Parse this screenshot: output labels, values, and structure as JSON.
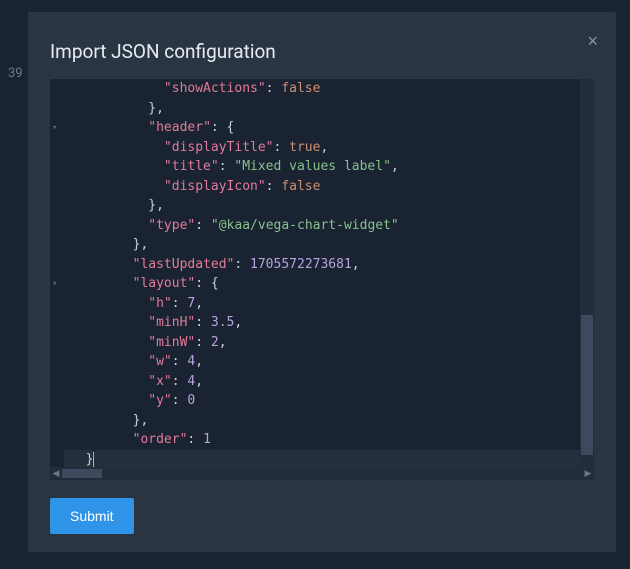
{
  "backdrop": {
    "text": "39"
  },
  "modal": {
    "title": "Import JSON configuration",
    "close_label": "×",
    "submit_label": "Submit"
  },
  "editor": {
    "fold_glyph": "▾",
    "hscroll": {
      "left_arrow": "◀",
      "right_arrow": "▶"
    },
    "lines": [
      {
        "indent": 6,
        "tokens": [
          {
            "t": "k",
            "v": "\"showActions\""
          },
          {
            "t": "p",
            "v": ": "
          },
          {
            "t": "b",
            "v": "false"
          }
        ]
      },
      {
        "indent": 5,
        "tokens": [
          {
            "t": "p",
            "v": "},"
          }
        ]
      },
      {
        "indent": 5,
        "tokens": [
          {
            "t": "k",
            "v": "\"header\""
          },
          {
            "t": "p",
            "v": ": {"
          }
        ]
      },
      {
        "indent": 6,
        "tokens": [
          {
            "t": "k",
            "v": "\"displayTitle\""
          },
          {
            "t": "p",
            "v": ": "
          },
          {
            "t": "b",
            "v": "true"
          },
          {
            "t": "p",
            "v": ","
          }
        ]
      },
      {
        "indent": 6,
        "tokens": [
          {
            "t": "k",
            "v": "\"title\""
          },
          {
            "t": "p",
            "v": ": "
          },
          {
            "t": "s",
            "v": "\"Mixed values label\""
          },
          {
            "t": "p",
            "v": ","
          }
        ]
      },
      {
        "indent": 6,
        "tokens": [
          {
            "t": "k",
            "v": "\"displayIcon\""
          },
          {
            "t": "p",
            "v": ": "
          },
          {
            "t": "b",
            "v": "false"
          }
        ]
      },
      {
        "indent": 5,
        "tokens": [
          {
            "t": "p",
            "v": "},"
          }
        ]
      },
      {
        "indent": 5,
        "tokens": [
          {
            "t": "k",
            "v": "\"type\""
          },
          {
            "t": "p",
            "v": ": "
          },
          {
            "t": "s",
            "v": "\"@kaa/vega-chart-widget\""
          }
        ]
      },
      {
        "indent": 4,
        "tokens": [
          {
            "t": "p",
            "v": "},"
          }
        ]
      },
      {
        "indent": 4,
        "tokens": [
          {
            "t": "k",
            "v": "\"lastUpdated\""
          },
          {
            "t": "p",
            "v": ": "
          },
          {
            "t": "n",
            "v": "1705572273681"
          },
          {
            "t": "p",
            "v": ","
          }
        ]
      },
      {
        "indent": 4,
        "tokens": [
          {
            "t": "k",
            "v": "\"layout\""
          },
          {
            "t": "p",
            "v": ": {"
          }
        ]
      },
      {
        "indent": 5,
        "tokens": [
          {
            "t": "k",
            "v": "\"h\""
          },
          {
            "t": "p",
            "v": ": "
          },
          {
            "t": "n",
            "v": "7"
          },
          {
            "t": "p",
            "v": ","
          }
        ]
      },
      {
        "indent": 5,
        "tokens": [
          {
            "t": "k",
            "v": "\"minH\""
          },
          {
            "t": "p",
            "v": ": "
          },
          {
            "t": "n",
            "v": "3.5"
          },
          {
            "t": "p",
            "v": ","
          }
        ]
      },
      {
        "indent": 5,
        "tokens": [
          {
            "t": "k",
            "v": "\"minW\""
          },
          {
            "t": "p",
            "v": ": "
          },
          {
            "t": "n",
            "v": "2"
          },
          {
            "t": "p",
            "v": ","
          }
        ]
      },
      {
        "indent": 5,
        "tokens": [
          {
            "t": "k",
            "v": "\"w\""
          },
          {
            "t": "p",
            "v": ": "
          },
          {
            "t": "n",
            "v": "4"
          },
          {
            "t": "p",
            "v": ","
          }
        ]
      },
      {
        "indent": 5,
        "tokens": [
          {
            "t": "k",
            "v": "\"x\""
          },
          {
            "t": "p",
            "v": ": "
          },
          {
            "t": "n",
            "v": "4"
          },
          {
            "t": "p",
            "v": ","
          }
        ]
      },
      {
        "indent": 5,
        "tokens": [
          {
            "t": "k",
            "v": "\"y\""
          },
          {
            "t": "p",
            "v": ": "
          },
          {
            "t": "n",
            "v": "0"
          }
        ]
      },
      {
        "indent": 4,
        "tokens": [
          {
            "t": "p",
            "v": "},"
          }
        ]
      },
      {
        "indent": 4,
        "tokens": [
          {
            "t": "k",
            "v": "\"order\""
          },
          {
            "t": "p",
            "v": ": "
          },
          {
            "t": "n",
            "v": "1"
          }
        ]
      },
      {
        "indent": 1,
        "cursor": true,
        "tokens": [
          {
            "t": "p",
            "v": "}"
          }
        ]
      }
    ],
    "fold_markers": [
      2,
      10
    ]
  }
}
